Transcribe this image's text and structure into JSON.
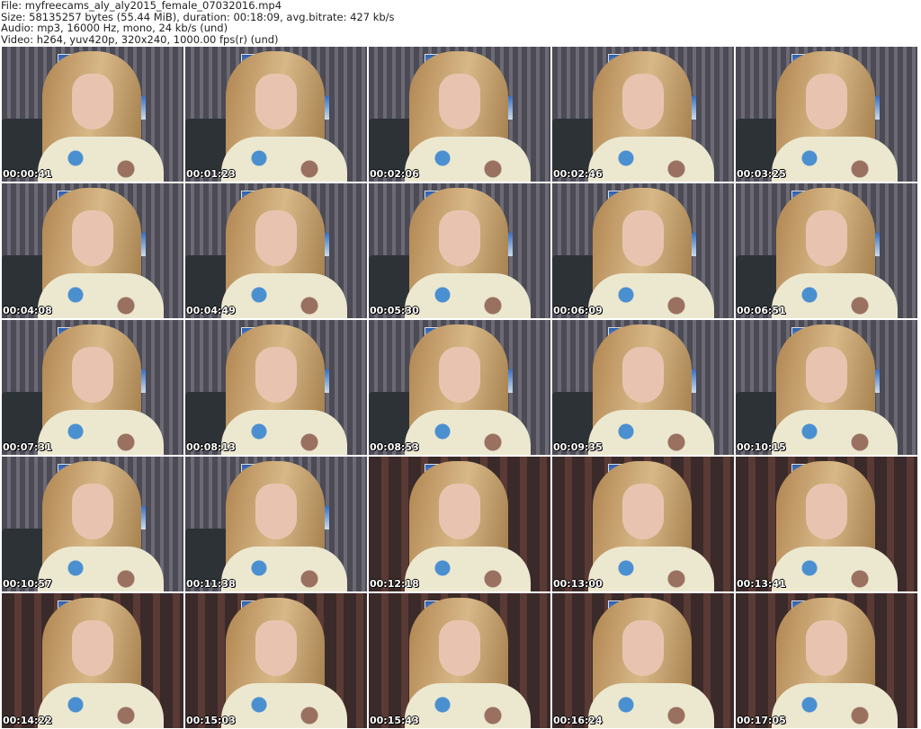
{
  "header": {
    "file": "File: myfreecams_aly_aly2015_female_07032016.mp4",
    "size": "Size: 58135257 bytes (55.44 MiB), duration: 00:18:09, avg.bitrate: 427 kb/s",
    "audio": "Audio: mp3, 16000 Hz, mono, 24 kb/s (und)",
    "video": "Video: h264, yuv420p, 320x240, 1000.00 fps(r) (und)"
  },
  "thumbnails": [
    {
      "timestamp": "00:00:41"
    },
    {
      "timestamp": "00:01:23"
    },
    {
      "timestamp": "00:02:06"
    },
    {
      "timestamp": "00:02:46"
    },
    {
      "timestamp": "00:03:25"
    },
    {
      "timestamp": "00:04:08"
    },
    {
      "timestamp": "00:04:49"
    },
    {
      "timestamp": "00:05:30"
    },
    {
      "timestamp": "00:06:09"
    },
    {
      "timestamp": "00:06:51"
    },
    {
      "timestamp": "00:07:31"
    },
    {
      "timestamp": "00:08:13"
    },
    {
      "timestamp": "00:08:53"
    },
    {
      "timestamp": "00:09:35"
    },
    {
      "timestamp": "00:10:15"
    },
    {
      "timestamp": "00:10:57"
    },
    {
      "timestamp": "00:11:38"
    },
    {
      "timestamp": "00:12:18"
    },
    {
      "timestamp": "00:13:00"
    },
    {
      "timestamp": "00:13:41"
    },
    {
      "timestamp": "00:14:22"
    },
    {
      "timestamp": "00:15:03"
    },
    {
      "timestamp": "00:15:43"
    },
    {
      "timestamp": "00:16:24"
    },
    {
      "timestamp": "00:17:05"
    }
  ]
}
